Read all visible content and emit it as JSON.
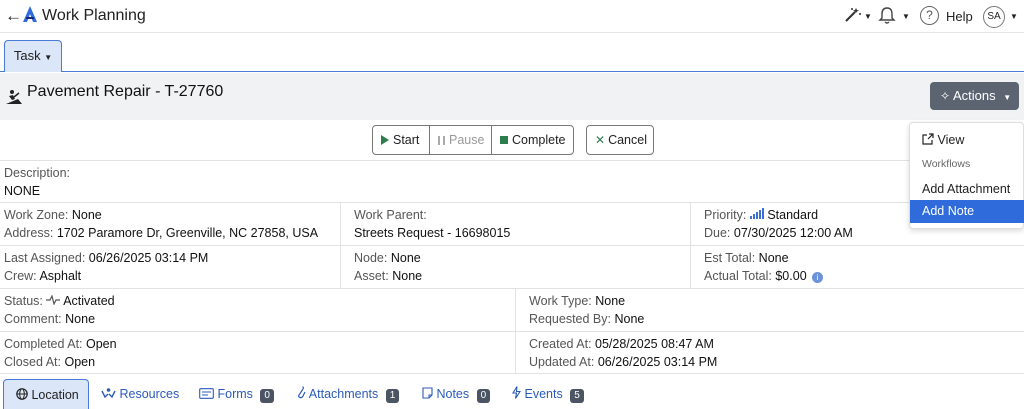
{
  "app": {
    "back_glyph": "←",
    "title": "Work Planning",
    "help_label": "Help",
    "avatar_initials": "SA"
  },
  "tabs": {
    "task_label": "Task"
  },
  "header": {
    "title": "Pavement Repair - T-27760",
    "actions_label": "Actions"
  },
  "toolbar": {
    "start_label": "Start",
    "pause_label": "Pause",
    "complete_label": "Complete",
    "cancel_label": "Cancel"
  },
  "details": {
    "description_label": "Description:",
    "description_value": "NONE",
    "work_zone_label": "Work Zone:",
    "work_zone_value": "None",
    "address_label": "Address:",
    "address_value": "1702 Paramore Dr, Greenville, NC 27858, USA",
    "work_parent_label": "Work Parent:",
    "work_parent_value": "Streets Request - 16698015",
    "priority_label": "Priority:",
    "priority_value": "Standard",
    "due_label": "Due:",
    "due_value": "07/30/2025 12:00 AM",
    "last_assigned_label": "Last Assigned:",
    "last_assigned_value": "06/26/2025 03:14 PM",
    "crew_label": "Crew:",
    "crew_value": "Asphalt",
    "node_label": "Node:",
    "node_value": "None",
    "asset_label": "Asset:",
    "asset_value": "None",
    "est_total_label": "Est Total:",
    "est_total_value": "None",
    "actual_total_label": "Actual Total:",
    "actual_total_value": "$0.00",
    "status_label": "Status:",
    "status_value": "Activated",
    "comment_label": "Comment:",
    "comment_value": "None",
    "work_type_label": "Work Type:",
    "work_type_value": "None",
    "requested_by_label": "Requested By:",
    "requested_by_value": "None",
    "completed_at_label": "Completed At:",
    "completed_at_value": "Open",
    "closed_at_label": "Closed At:",
    "closed_at_value": "Open",
    "created_at_label": "Created At:",
    "created_at_value": "05/28/2025 08:47 AM",
    "updated_at_label": "Updated At:",
    "updated_at_value": "06/26/2025 03:14 PM"
  },
  "bottom_tabs": {
    "location": "Location",
    "resources": "Resources",
    "forms": "Forms",
    "forms_count": "0",
    "attachments": "Attachments",
    "attachments_count": "1",
    "notes": "Notes",
    "notes_count": "0",
    "events": "Events",
    "events_count": "5"
  },
  "actions_menu": {
    "view": "View",
    "workflows_header": "Workflows",
    "add_attachment": "Add Attachment",
    "add_note": "Add Note"
  },
  "colors": {
    "accent": "#2f6bda",
    "tab_active_bg": "#dbe6f8",
    "actions_bg": "#5b6470",
    "success_green": "#2e7d4f"
  }
}
